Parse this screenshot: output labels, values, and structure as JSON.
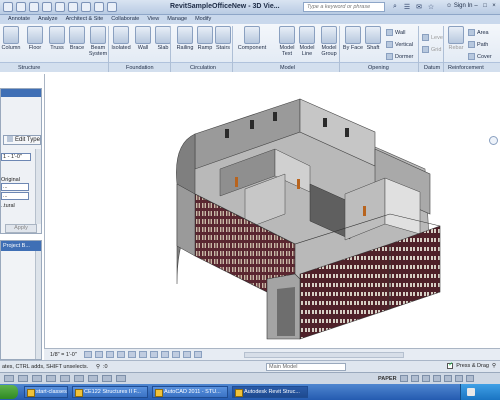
{
  "title_bar": {
    "title": "RevitSampleOfficeNew - 3D Vie...",
    "search_placeholder": "Type a keyword or phrase",
    "sign_in": "Sign In",
    "window_buttons": [
      "–",
      "□",
      "×"
    ]
  },
  "ribbon": {
    "tabs": [
      "Annotate",
      "Analyze",
      "Architect & Site",
      "Collaborate",
      "View",
      "Manage",
      "Modify"
    ],
    "active_tab": "Home",
    "tools": {
      "column": "Column",
      "floor": "Floor",
      "truss": "Truss",
      "brace": "Brace",
      "beam_system": "Beam System",
      "isolated": "Isolated",
      "wall": "Wall",
      "slab": "Slab",
      "railing": "Railing",
      "ramp": "Ramp",
      "stairs": "Stairs",
      "component": "Component",
      "model_text": "Model Text",
      "model_line": "Model Line",
      "model_group": "Model Group",
      "by_face": "By Face",
      "shaft": "Shaft",
      "open_wall": "Wall",
      "vertical": "Vertical",
      "dormer": "Dormer",
      "level": "Level",
      "grid": "Grid",
      "rebar": "Rebar",
      "area": "Area",
      "path": "Path",
      "cover": "Cover"
    },
    "panels": [
      "Structure",
      "Foundation",
      "Circulation",
      "Model",
      "Opening",
      "Datum",
      "Reinforcement"
    ]
  },
  "properties_palette": {
    "edit_type": "Edit Type",
    "rows": [
      "1 - 1'-0\"",
      "Original",
      "...",
      "...",
      "..tural"
    ],
    "apply": "Apply"
  },
  "project_browser": {
    "title": "Project B..."
  },
  "view_control": {
    "scale": "1/8\" = 1'-0\""
  },
  "status_bar": {
    "text": "ates, CTRL adds, SHIFT unselects.",
    "zero": ":0",
    "model_select": "Main Model",
    "press_drag": "Press & Drag"
  },
  "cad_bar": {
    "paper": "PAPER"
  },
  "taskbar": {
    "items": [
      "start-classes-principle...",
      "CE122 Structures II F...",
      "AutoCAD 2011 - STU...",
      "Autodesk Revit Struc..."
    ],
    "active_index": 3
  },
  "colors": {
    "brick": "#5a2630",
    "wall_grey": "#8a8a8a",
    "selection_blue": "#3f6fb5"
  }
}
